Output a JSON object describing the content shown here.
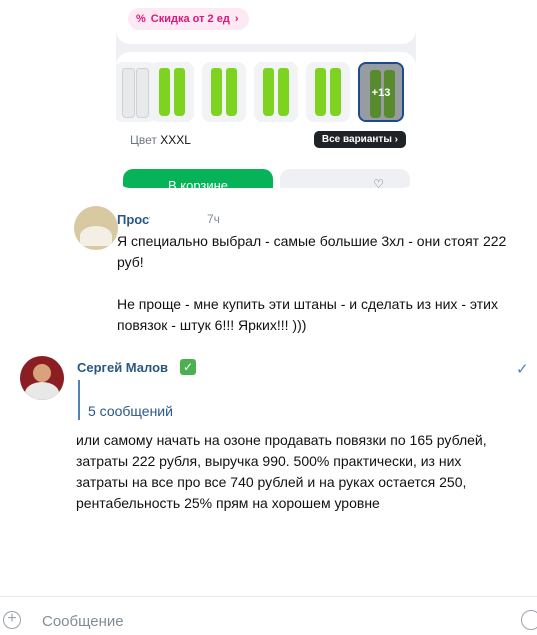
{
  "product_card": {
    "discount_badge": "Скидка от 2 ед",
    "more_variants": "+13",
    "color_label": "Цвет",
    "color_value": "XXXL",
    "all_variants_button": "Все варианты",
    "cart_button": "В корзине",
    "colors": {
      "accent_green": "#07b359",
      "legging_green": "#7ed321",
      "badge_pink": "#e0157a"
    }
  },
  "messages": [
    {
      "author": "Прост",
      "time": "7ч",
      "text": "Я специально выбрал - самые большие 3хл - они стоят 222 руб!\n\nНе проще - мне купить эти штаны - и сделать из них - этих повязок - штук 6!!! Ярких!!! )))"
    },
    {
      "author": "Сергей Малов",
      "verified": "✅",
      "reply_count": "5 сообщений",
      "text": "или самому начать на озоне продавать повязки по 165 рублей, затраты 222 рубля, выручка 990. 500% практически, из них затраты на все про все 740 рублей и на руках остается 250, рентабельность 25% прям на хорошем уровне"
    }
  ],
  "composer": {
    "placeholder": "Сообщение"
  },
  "colors": {
    "link_blue": "#2a5885",
    "meta_gray": "#818c99"
  }
}
